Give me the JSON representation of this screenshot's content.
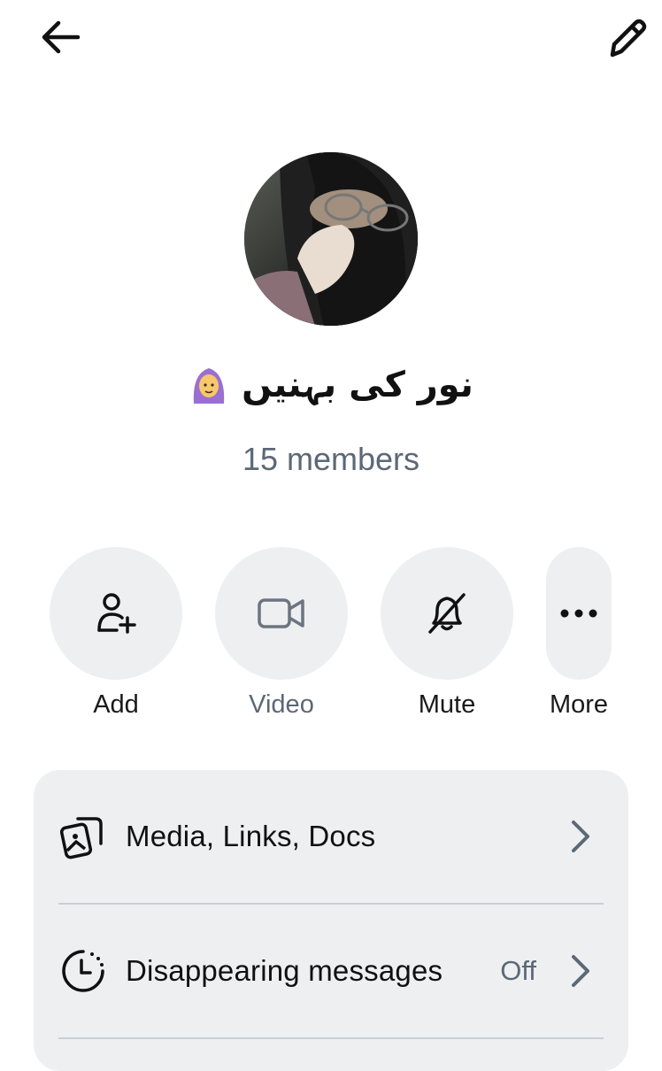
{
  "header": {
    "back_icon": "arrow-left-icon",
    "edit_icon": "pencil-icon"
  },
  "group": {
    "name": "نور کی بہنیں",
    "name_emoji": "woman-with-headscarf-emoji",
    "members": "15 members"
  },
  "actions": [
    {
      "label": "Add",
      "icon": "add-person-icon"
    },
    {
      "label": "Video",
      "icon": "video-camera-icon"
    },
    {
      "label": "Mute",
      "icon": "bell-off-icon"
    },
    {
      "label": "More",
      "icon": "more-dots-icon"
    }
  ],
  "settings": {
    "media": {
      "label": "Media, Links, Docs",
      "icon": "media-gallery-icon"
    },
    "disappearing": {
      "label": "Disappearing messages",
      "value": "Off",
      "icon": "timer-icon"
    }
  },
  "colors": {
    "accent_gray": "#5b6876",
    "surface": "#eeeff1",
    "divider": "#c8d0d6"
  }
}
